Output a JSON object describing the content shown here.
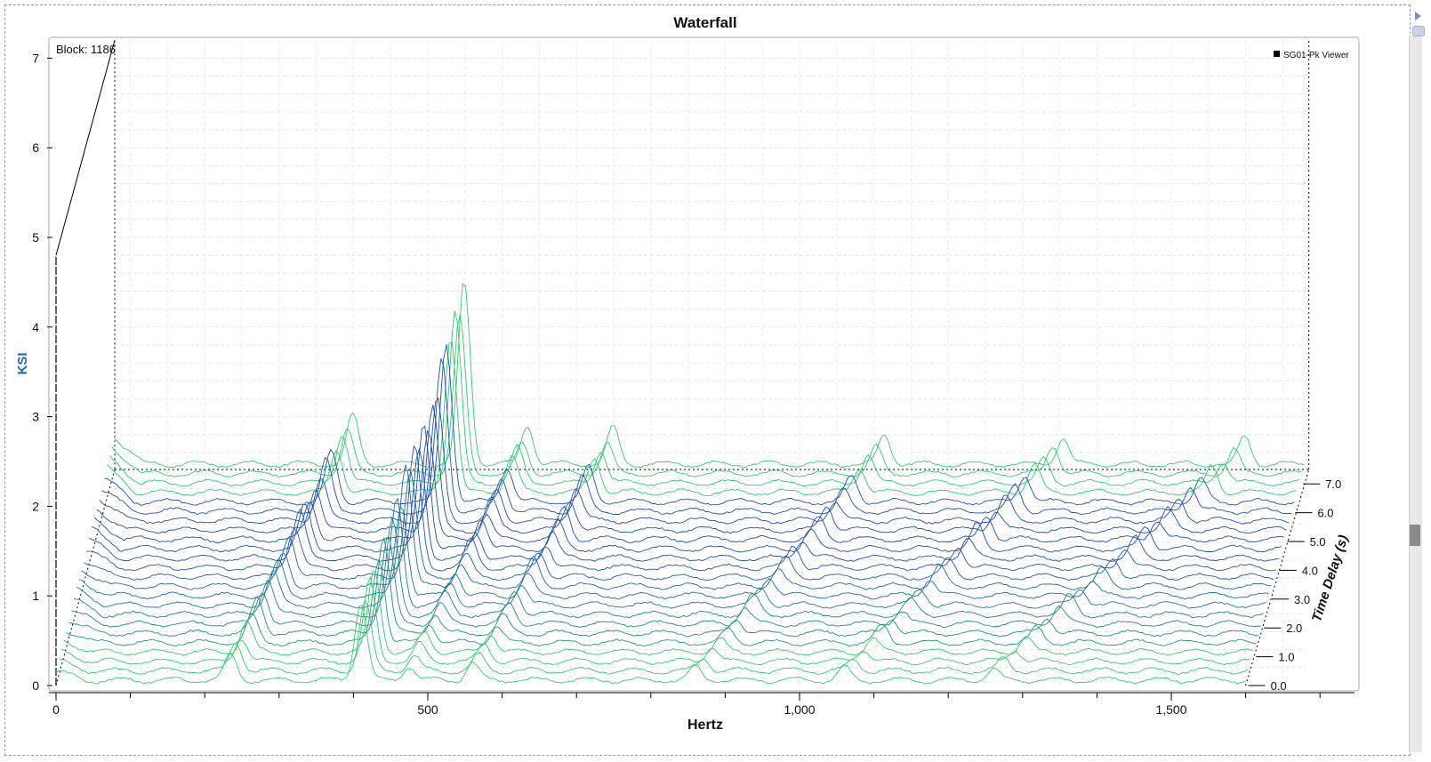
{
  "chart_data": {
    "type": "waterfall",
    "title": "Waterfall",
    "xlabel": "Hertz",
    "ylabel": "KSI",
    "zlabel": "Time Delay (s)",
    "block_label": "Block: 1186",
    "legend": [
      "SG01-Pk Viewer"
    ],
    "legend_position": "top-right",
    "xlim": [
      0,
      1750
    ],
    "ylim": [
      0,
      7.2
    ],
    "zlim": [
      0,
      7.5
    ],
    "x_ticks": [
      0,
      500,
      1000,
      1500
    ],
    "x_tick_labels": [
      "0",
      "500",
      "1,000",
      "1,500"
    ],
    "y_ticks": [
      0,
      1,
      2,
      3,
      4,
      5,
      6,
      7
    ],
    "y_tick_labels": [
      "0",
      "1",
      "2",
      "3",
      "4",
      "5",
      "6",
      "7"
    ],
    "z_ticks": [
      0,
      1,
      2,
      3,
      4,
      5,
      6,
      7
    ],
    "z_tick_labels": [
      "0.0",
      "1.0",
      "2.0",
      "3.0",
      "4.0",
      "5.0",
      "6.0",
      "7.0"
    ],
    "grid": true,
    "colors": {
      "low": "#2ecc71",
      "mid": "#1f9e7a",
      "high": "#1a1ad0"
    },
    "baseline_ksi": 0.05,
    "traces": 24,
    "peaks": [
      {
        "freq_start": 235,
        "freq_end": 320,
        "height": 0.6
      },
      {
        "freq_start": 410,
        "freq_end": 470,
        "height": 1.8
      },
      {
        "freq_start": 475,
        "freq_end": 555,
        "height": 0.4
      },
      {
        "freq_start": 560,
        "freq_end": 670,
        "height": 0.4
      },
      {
        "freq_start": 860,
        "freq_end": 1035,
        "height": 0.3
      },
      {
        "freq_start": 1060,
        "freq_end": 1275,
        "height": 0.3
      },
      {
        "freq_start": 1260,
        "freq_end": 1520,
        "height": 0.3
      }
    ]
  }
}
